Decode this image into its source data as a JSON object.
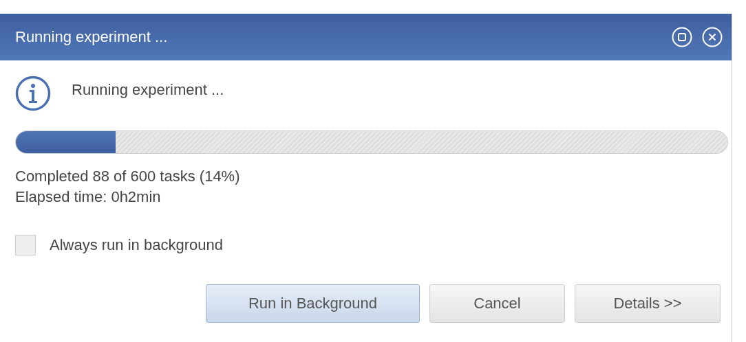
{
  "window": {
    "title": "Running experiment ..."
  },
  "message": "Running experiment ...",
  "progress": {
    "level": 0.14
  },
  "status_lines": [
    "Completed 88 of 600 tasks (14%)",
    "Elapsed time: 0h2min"
  ],
  "checkbox": {
    "label": "Always run in background",
    "checked": false
  },
  "buttons": [
    {
      "label": "Run in Background",
      "default": true
    },
    {
      "label": "Cancel",
      "default": false
    },
    {
      "label": "Details >>",
      "default": false
    }
  ]
}
